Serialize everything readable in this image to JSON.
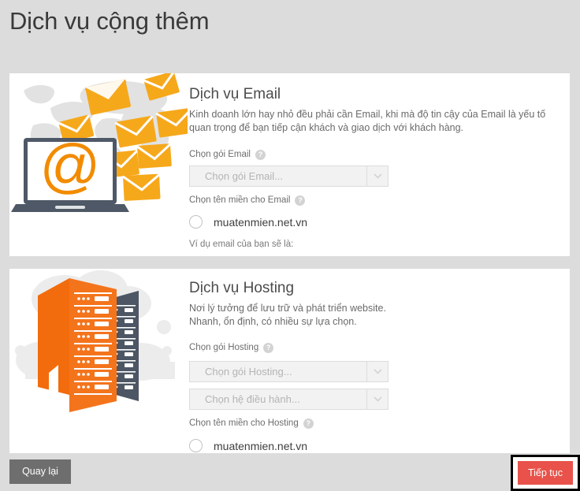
{
  "page": {
    "title": "Dịch vụ cộng thêm",
    "background_color": "#dcdcdc",
    "panel_color": "#ffffff"
  },
  "services": [
    {
      "id": "email",
      "title": "Dịch vụ Email",
      "description": "Kinh doanh lớn hay nhỏ đều phải cần Email, khi mà độ tin cậy của Email là yếu tố quan trọng để bạn tiếp cận khách và giao dịch với khách hàng.",
      "illustration": "email-laptop-envelopes-illustration",
      "package_label": "Chọn gói Email",
      "package_help_icon": "help-icon",
      "package_placeholder": "Chọn gói Email...",
      "domain_label": "Chọn tên miền cho Email",
      "domain_help_icon": "help-icon",
      "domain_option": "muatenmien.net.vn",
      "hint": "Ví dụ email của bạn sẽ là:"
    },
    {
      "id": "hosting",
      "title": "Dịch vụ Hosting",
      "description_line1": "Nơi lý tưởng để lưu trữ và phát triển website.",
      "description_line2": "Nhanh, ổn định, có nhiều sự lựa chọn.",
      "illustration": "hosting-servers-cloud-illustration",
      "package_label": "Chọn gói Hosting",
      "package_help_icon": "help-icon",
      "package_placeholder": "Chọn gói Hosting...",
      "os_placeholder": "Chọn hệ điều hành...",
      "domain_label": "Chọn tên miền cho Hosting",
      "domain_help_icon": "help-icon",
      "domain_option": "muatenmien.net.vn"
    }
  ],
  "footer": {
    "back_label": "Quay lại",
    "back_color": "#6e6e6e",
    "next_label": "Tiếp tục",
    "next_color": "#e8524a",
    "next_highlight_color": "#000000"
  },
  "icons": {
    "help": "?",
    "chevron_down": "chevron-down-icon"
  }
}
